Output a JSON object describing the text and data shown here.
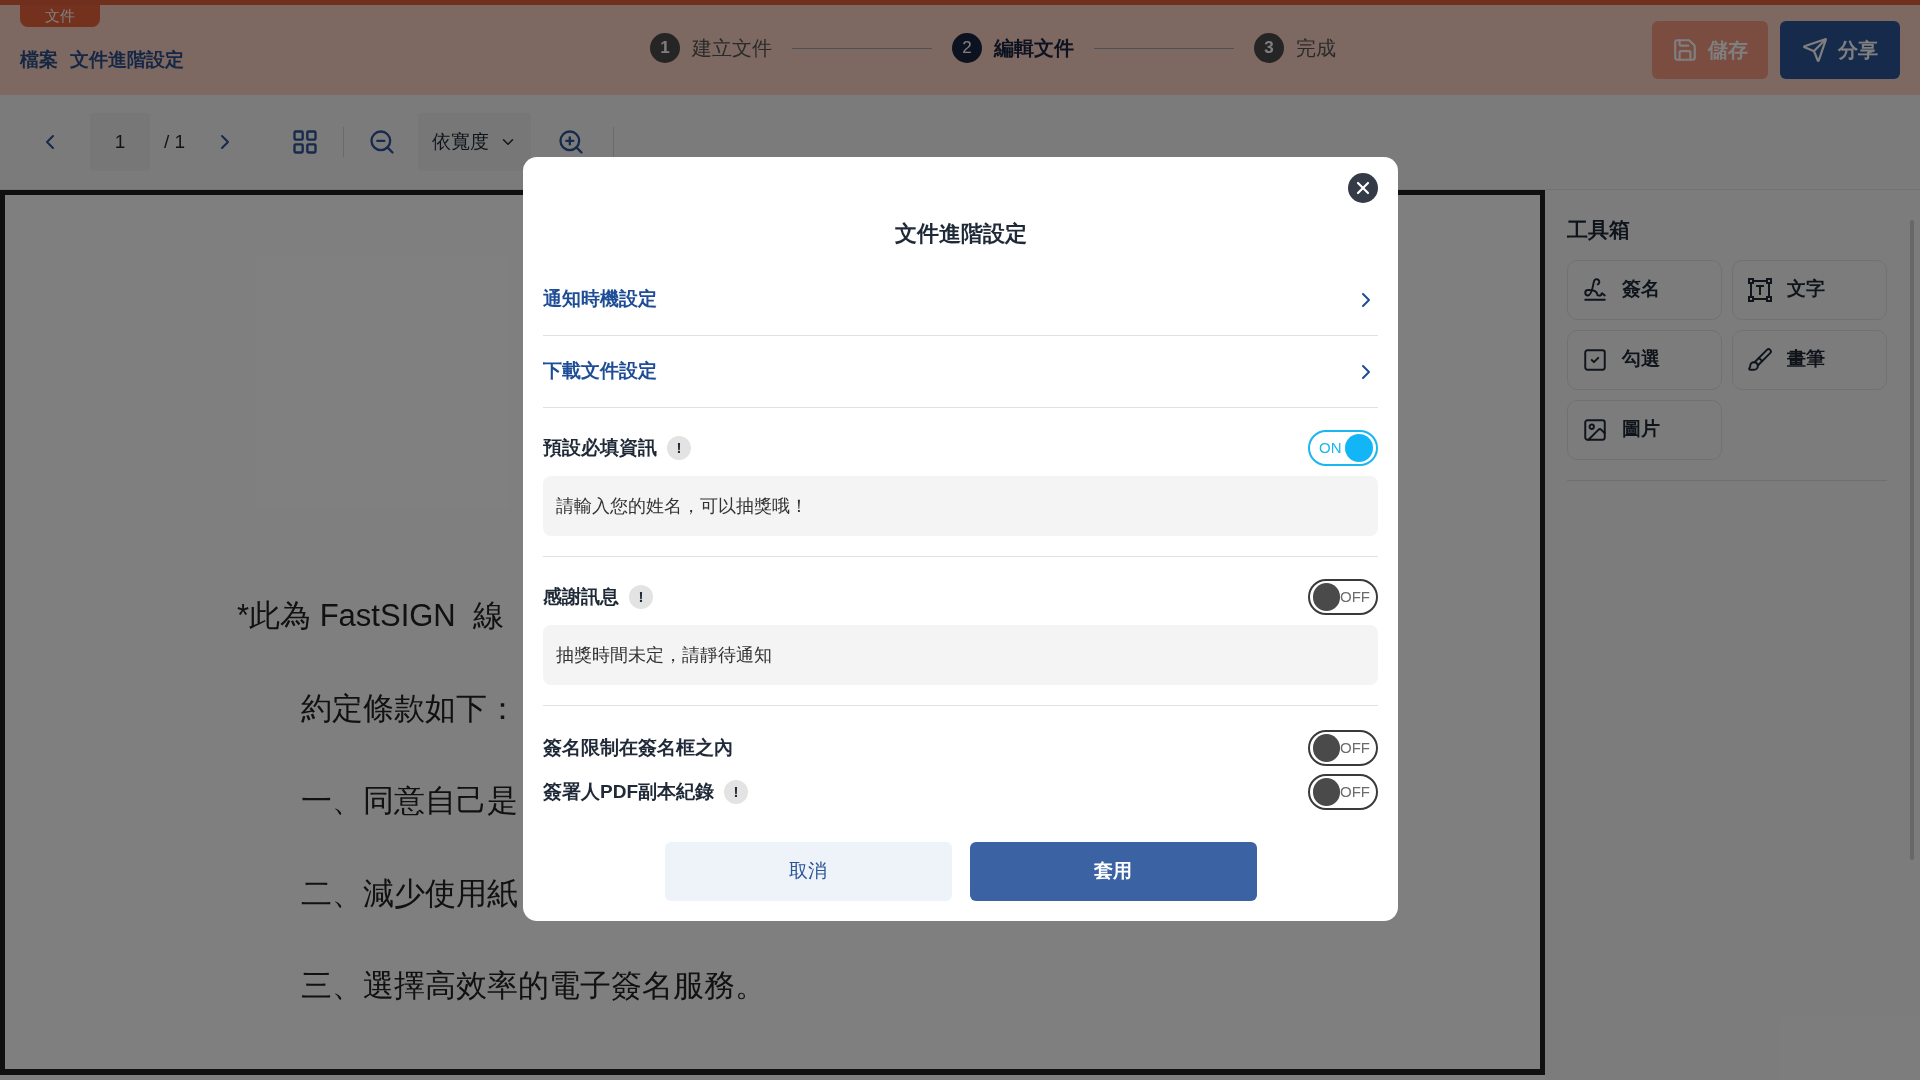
{
  "header": {
    "tab_label": "文件",
    "breadcrumb": [
      "檔案",
      "文件進階設定"
    ],
    "steps": [
      {
        "number": "1",
        "label": "建立文件",
        "selected": false
      },
      {
        "number": "2",
        "label": "編輯文件",
        "selected": true
      },
      {
        "number": "3",
        "label": "完成",
        "selected": false
      }
    ],
    "buttons": [
      {
        "kind": "save",
        "label": "儲存"
      },
      {
        "kind": "share",
        "label": "分享"
      }
    ]
  },
  "toolbar": {
    "page": "1",
    "page_total": "/ 1",
    "zoom_mode": "依寬度"
  },
  "document": {
    "lines": [
      "*此為 FastSIGN  線",
      "約定條款如下：",
      "一、同意自己是",
      "二、減少使用紙",
      "三、選擇高效率的電子簽名服務。"
    ]
  },
  "toolbox": {
    "title": "工具箱",
    "tools": [
      {
        "kind": "signature",
        "label": "簽名"
      },
      {
        "kind": "text",
        "label": "文字"
      },
      {
        "kind": "check",
        "label": "勾選"
      },
      {
        "kind": "brush",
        "label": "畫筆"
      },
      {
        "kind": "image",
        "label": "圖片"
      }
    ]
  },
  "dialog": {
    "title": "文件進階設定",
    "links": [
      "通知時機設定",
      "下載文件設定"
    ],
    "settings": [
      {
        "label": "預設必填資訊",
        "info_mark": "!",
        "on": true,
        "toggle_text": "ON",
        "value": "請輸入您的姓名，可以抽獎哦！"
      },
      {
        "label": "感謝訊息",
        "info_mark": "!",
        "on": false,
        "toggle_text": "OFF",
        "value": "抽獎時間未定，請靜待通知"
      },
      {
        "label": "簽名限制在簽名框之內",
        "on": false,
        "toggle_text": "OFF"
      },
      {
        "label": "簽署人PDF副本紀錄",
        "info_mark": "!",
        "on": false,
        "toggle_text": "OFF"
      }
    ],
    "buttons": [
      {
        "kind": "secondary",
        "label": "取消"
      },
      {
        "kind": "primary",
        "label": "套用"
      }
    ]
  }
}
